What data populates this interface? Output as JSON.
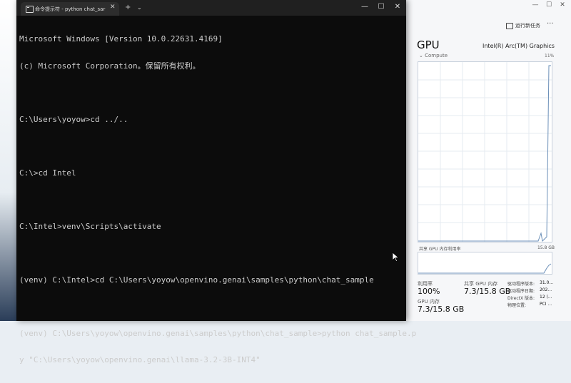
{
  "terminal": {
    "tab_title": "命令提示符 - python  chat_sar",
    "tab_close": "✕",
    "new_tab": "+",
    "dropdown": "⌄",
    "window_buttons": [
      "—",
      "☐",
      "✕"
    ],
    "lines": [
      "Microsoft Windows [Version 10.0.22631.4169]",
      "(c) Microsoft Corporation。保留所有权利。",
      "",
      "C:\\Users\\yoyow>cd ../..",
      "",
      "C:\\>cd Intel",
      "",
      "C:\\Intel>venv\\Scripts\\activate",
      "",
      "(venv) C:\\Intel>cd C:\\Users\\yoyow\\openvino.genai\\samples\\python\\chat_sample",
      "",
      "(venv) C:\\Users\\yoyow\\openvino.genai\\samples\\python\\chat_sample>python chat_sample.p",
      "y \"C:\\Users\\yoyow\\openvino.genai\\llama-3.2-3B-INT4\""
    ]
  },
  "task_manager": {
    "window_buttons": [
      "—",
      "☐",
      "✕"
    ],
    "run_new_task": "运行新任务",
    "more": "···",
    "gpu_title": "GPU",
    "gpu_name": "Intel(R) Arc(TM) Graphics",
    "compute_label": "Compute",
    "compute_percent": "11%",
    "shared_memory_label": "共享 GPU 内存利用率",
    "shared_memory_max": "15.8 GB",
    "utilization_label": "利用率",
    "utilization_value": "100%",
    "shared_gpu_label": "共享 GPU 内存",
    "shared_gpu_value": "7.3/15.8 GB",
    "gpu_memory_label": "GPU 内存",
    "gpu_memory_value": "7.3/15.8 GB",
    "details": [
      {
        "key": "驱动程序版本:",
        "value": "31.0..."
      },
      {
        "key": "驱动程序日期:",
        "value": "202..."
      },
      {
        "key": "DirectX 版本:",
        "value": "12 (..."
      },
      {
        "key": "物理位置:",
        "value": "PCI ..."
      }
    ]
  }
}
